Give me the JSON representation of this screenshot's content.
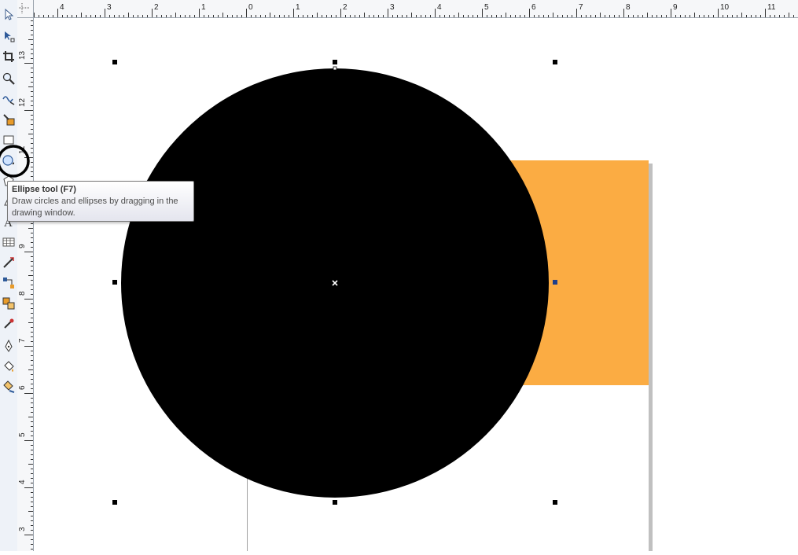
{
  "tools": [
    {
      "name": "pick-tool-icon"
    },
    {
      "name": "shape-tool-icon"
    },
    {
      "name": "crop-tool-icon"
    },
    {
      "name": "zoom-tool-icon"
    },
    {
      "name": "freehand-tool-icon"
    },
    {
      "name": "smart-fill-tool-icon"
    },
    {
      "name": "rectangle-tool-icon"
    },
    {
      "name": "ellipse-tool-icon"
    },
    {
      "name": "polygon-tool-icon"
    },
    {
      "name": "basic-shapes-tool-icon"
    },
    {
      "name": "text-tool-icon"
    },
    {
      "name": "table-tool-icon"
    },
    {
      "name": "dimension-tool-icon"
    },
    {
      "name": "connector-tool-icon"
    },
    {
      "name": "blend-tool-icon"
    },
    {
      "name": "eyedropper-tool-icon"
    },
    {
      "name": "outline-pen-tool-icon"
    },
    {
      "name": "fill-tool-icon"
    },
    {
      "name": "interactive-fill-tool-icon"
    }
  ],
  "ruler": {
    "horizontal_labels": [
      "4",
      "3",
      "2",
      "1",
      "0",
      "1",
      "2",
      "3",
      "4",
      "5",
      "6",
      "7",
      "8",
      "9",
      "10",
      "11"
    ],
    "vertical_labels": [
      "13",
      "12",
      "11",
      "10",
      "9",
      "8",
      "7",
      "6",
      "5",
      "4",
      "3"
    ]
  },
  "tooltip": {
    "title": "Ellipse tool (F7)",
    "description": "Draw circles and ellipses by dragging in the drawing window."
  },
  "colors": {
    "ellipse_fill": "#000000",
    "rectangle_fill": "#fbac43",
    "highlight_circle": "#000000"
  }
}
